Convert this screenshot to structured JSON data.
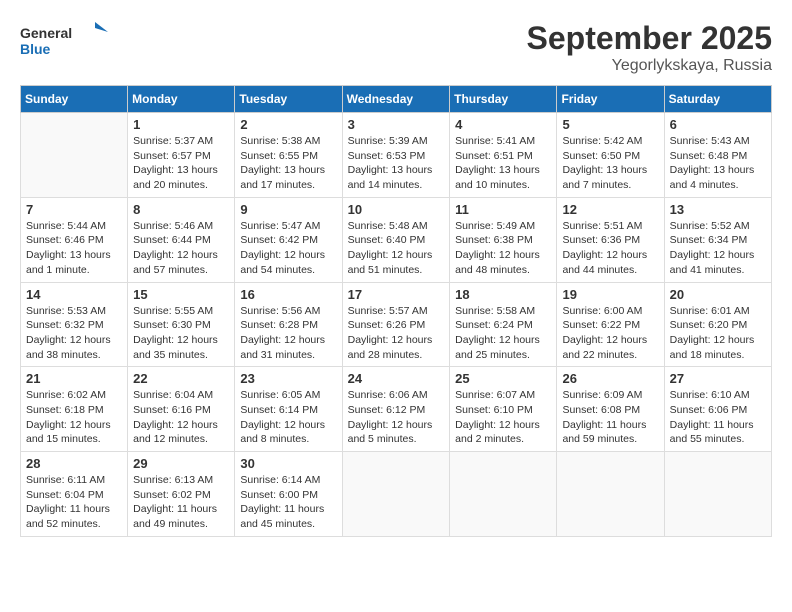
{
  "header": {
    "logo_general": "General",
    "logo_blue": "Blue",
    "month": "September 2025",
    "location": "Yegorlykskaya, Russia"
  },
  "weekdays": [
    "Sunday",
    "Monday",
    "Tuesday",
    "Wednesday",
    "Thursday",
    "Friday",
    "Saturday"
  ],
  "weeks": [
    [
      {
        "day": "",
        "detail": ""
      },
      {
        "day": "1",
        "detail": "Sunrise: 5:37 AM\nSunset: 6:57 PM\nDaylight: 13 hours\nand 20 minutes."
      },
      {
        "day": "2",
        "detail": "Sunrise: 5:38 AM\nSunset: 6:55 PM\nDaylight: 13 hours\nand 17 minutes."
      },
      {
        "day": "3",
        "detail": "Sunrise: 5:39 AM\nSunset: 6:53 PM\nDaylight: 13 hours\nand 14 minutes."
      },
      {
        "day": "4",
        "detail": "Sunrise: 5:41 AM\nSunset: 6:51 PM\nDaylight: 13 hours\nand 10 minutes."
      },
      {
        "day": "5",
        "detail": "Sunrise: 5:42 AM\nSunset: 6:50 PM\nDaylight: 13 hours\nand 7 minutes."
      },
      {
        "day": "6",
        "detail": "Sunrise: 5:43 AM\nSunset: 6:48 PM\nDaylight: 13 hours\nand 4 minutes."
      }
    ],
    [
      {
        "day": "7",
        "detail": "Sunrise: 5:44 AM\nSunset: 6:46 PM\nDaylight: 13 hours\nand 1 minute."
      },
      {
        "day": "8",
        "detail": "Sunrise: 5:46 AM\nSunset: 6:44 PM\nDaylight: 12 hours\nand 57 minutes."
      },
      {
        "day": "9",
        "detail": "Sunrise: 5:47 AM\nSunset: 6:42 PM\nDaylight: 12 hours\nand 54 minutes."
      },
      {
        "day": "10",
        "detail": "Sunrise: 5:48 AM\nSunset: 6:40 PM\nDaylight: 12 hours\nand 51 minutes."
      },
      {
        "day": "11",
        "detail": "Sunrise: 5:49 AM\nSunset: 6:38 PM\nDaylight: 12 hours\nand 48 minutes."
      },
      {
        "day": "12",
        "detail": "Sunrise: 5:51 AM\nSunset: 6:36 PM\nDaylight: 12 hours\nand 44 minutes."
      },
      {
        "day": "13",
        "detail": "Sunrise: 5:52 AM\nSunset: 6:34 PM\nDaylight: 12 hours\nand 41 minutes."
      }
    ],
    [
      {
        "day": "14",
        "detail": "Sunrise: 5:53 AM\nSunset: 6:32 PM\nDaylight: 12 hours\nand 38 minutes."
      },
      {
        "day": "15",
        "detail": "Sunrise: 5:55 AM\nSunset: 6:30 PM\nDaylight: 12 hours\nand 35 minutes."
      },
      {
        "day": "16",
        "detail": "Sunrise: 5:56 AM\nSunset: 6:28 PM\nDaylight: 12 hours\nand 31 minutes."
      },
      {
        "day": "17",
        "detail": "Sunrise: 5:57 AM\nSunset: 6:26 PM\nDaylight: 12 hours\nand 28 minutes."
      },
      {
        "day": "18",
        "detail": "Sunrise: 5:58 AM\nSunset: 6:24 PM\nDaylight: 12 hours\nand 25 minutes."
      },
      {
        "day": "19",
        "detail": "Sunrise: 6:00 AM\nSunset: 6:22 PM\nDaylight: 12 hours\nand 22 minutes."
      },
      {
        "day": "20",
        "detail": "Sunrise: 6:01 AM\nSunset: 6:20 PM\nDaylight: 12 hours\nand 18 minutes."
      }
    ],
    [
      {
        "day": "21",
        "detail": "Sunrise: 6:02 AM\nSunset: 6:18 PM\nDaylight: 12 hours\nand 15 minutes."
      },
      {
        "day": "22",
        "detail": "Sunrise: 6:04 AM\nSunset: 6:16 PM\nDaylight: 12 hours\nand 12 minutes."
      },
      {
        "day": "23",
        "detail": "Sunrise: 6:05 AM\nSunset: 6:14 PM\nDaylight: 12 hours\nand 8 minutes."
      },
      {
        "day": "24",
        "detail": "Sunrise: 6:06 AM\nSunset: 6:12 PM\nDaylight: 12 hours\nand 5 minutes."
      },
      {
        "day": "25",
        "detail": "Sunrise: 6:07 AM\nSunset: 6:10 PM\nDaylight: 12 hours\nand 2 minutes."
      },
      {
        "day": "26",
        "detail": "Sunrise: 6:09 AM\nSunset: 6:08 PM\nDaylight: 11 hours\nand 59 minutes."
      },
      {
        "day": "27",
        "detail": "Sunrise: 6:10 AM\nSunset: 6:06 PM\nDaylight: 11 hours\nand 55 minutes."
      }
    ],
    [
      {
        "day": "28",
        "detail": "Sunrise: 6:11 AM\nSunset: 6:04 PM\nDaylight: 11 hours\nand 52 minutes."
      },
      {
        "day": "29",
        "detail": "Sunrise: 6:13 AM\nSunset: 6:02 PM\nDaylight: 11 hours\nand 49 minutes."
      },
      {
        "day": "30",
        "detail": "Sunrise: 6:14 AM\nSunset: 6:00 PM\nDaylight: 11 hours\nand 45 minutes."
      },
      {
        "day": "",
        "detail": ""
      },
      {
        "day": "",
        "detail": ""
      },
      {
        "day": "",
        "detail": ""
      },
      {
        "day": "",
        "detail": ""
      }
    ]
  ]
}
